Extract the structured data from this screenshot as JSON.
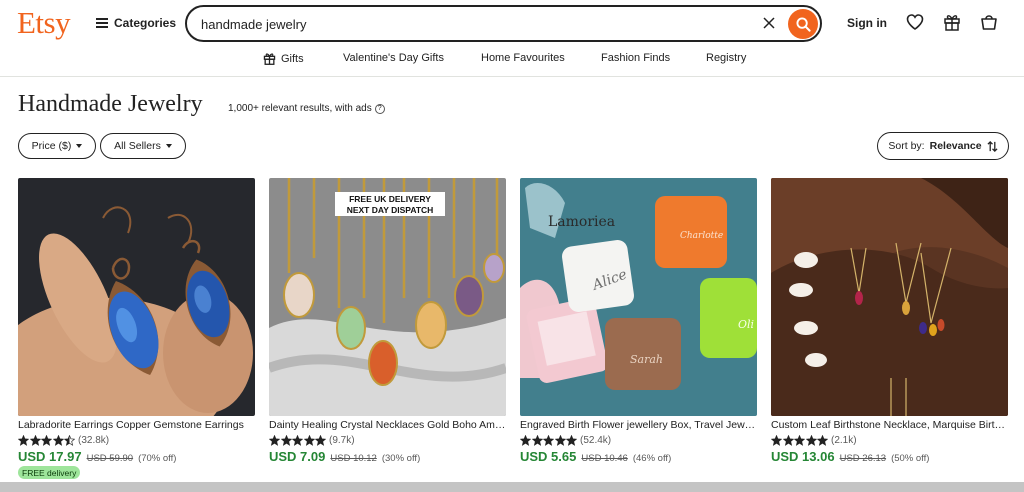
{
  "header": {
    "logo": "Etsy",
    "categories_label": "Categories",
    "search_value": "handmade jewelry",
    "signin_label": "Sign in"
  },
  "nav": {
    "items": [
      "Gifts",
      "Valentine's Day Gifts",
      "Home Favourites",
      "Fashion Finds",
      "Registry"
    ]
  },
  "page": {
    "title": "Handmade Jewelry",
    "results": "1,000+ relevant results, with ads"
  },
  "filters": {
    "price": "Price ($)",
    "sellers": "All Sellers",
    "sort_prefix": "Sort by:",
    "sort_value": "Relevance"
  },
  "products": [
    {
      "title": "Labradorite Earrings Copper Gemstone Earrings",
      "rating": 4.5,
      "reviews": "(32.8k)",
      "price": "USD 17.97",
      "original": "USD 59.90",
      "discount": "(70% off)",
      "badge": "FREE delivery"
    },
    {
      "title": "Dainty Healing Crystal Necklaces Gold Boho Amethyst",
      "rating": 5,
      "reviews": "(9.7k)",
      "price": "USD 7.09",
      "original": "USD 10.12",
      "discount": "(30% off)",
      "badge": ""
    },
    {
      "title": "Engraved Birth Flower jewellery Box, Travel Jewellery Case",
      "rating": 5,
      "reviews": "(52.4k)",
      "price": "USD 5.65",
      "original": "USD 10.46",
      "discount": "(46% off)",
      "badge": ""
    },
    {
      "title": "Custom Leaf Birthstone Necklace, Marquise Birthstone",
      "rating": 5,
      "reviews": "(2.1k)",
      "price": "USD 13.06",
      "original": "USD 26.13",
      "discount": "(50% off)",
      "badge": ""
    }
  ],
  "image_text": {
    "crystal_banner_1": "FREE UK DELIVERY",
    "crystal_banner_2": "NEXT DAY DISPATCH",
    "box_brand": "Lamoriea",
    "box_name_1": "Alice",
    "box_name_2": "Charlotte",
    "box_name_3": "Sarah",
    "box_name_4": "Oli"
  },
  "colors": {
    "brand": "#F1641E",
    "price": "#258635",
    "badge": "#9EE59B"
  }
}
